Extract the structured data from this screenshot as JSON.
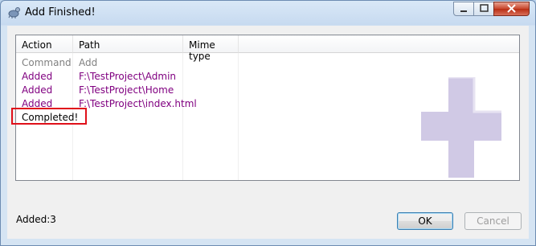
{
  "window": {
    "title": "Add Finished!"
  },
  "table": {
    "columns": [
      "Action",
      "Path",
      "Mime type"
    ],
    "rows": [
      {
        "action": "Command",
        "path": "Add",
        "mime": ""
      },
      {
        "action": "Added",
        "path": "F:\\TestProject\\Admin",
        "mime": ""
      },
      {
        "action": "Added",
        "path": "F:\\TestProject\\Home",
        "mime": ""
      },
      {
        "action": "Added",
        "path": "F:\\TestProject\\index.html",
        "mime": ""
      },
      {
        "action": "Completed!",
        "path": "",
        "mime": ""
      }
    ]
  },
  "status": {
    "text": "Added:3"
  },
  "buttons": {
    "ok": "OK",
    "cancel": "Cancel"
  },
  "colors": {
    "added": "#800080",
    "command": "#808080",
    "plus": "#c8c0e0"
  }
}
